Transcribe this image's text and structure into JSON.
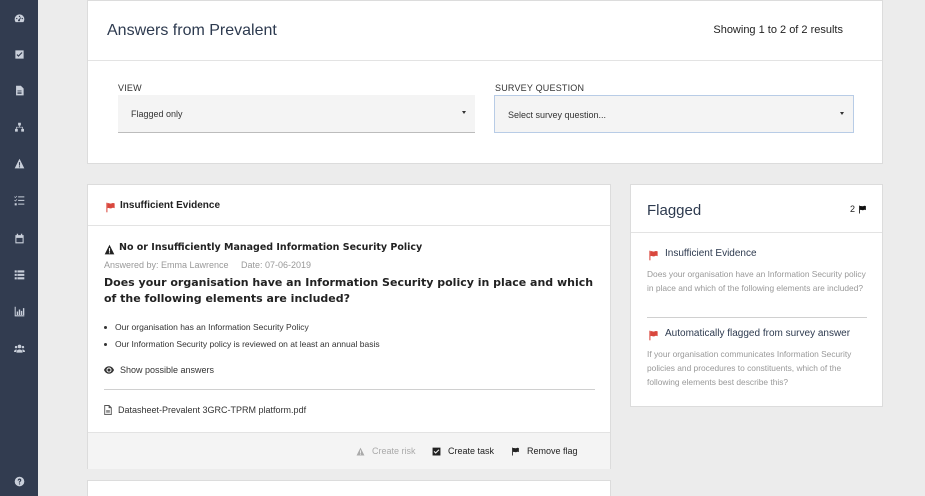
{
  "sidebar": {
    "icons": [
      "dashboard-icon",
      "checkbox-icon",
      "document-icon",
      "sitemap-icon",
      "warning-icon",
      "tasklist-icon",
      "calendar-icon",
      "list-icon",
      "chart-icon",
      "users-icon",
      "help-icon"
    ]
  },
  "header": {
    "title": "Answers from Prevalent",
    "results": "Showing 1 to 2 of 2 results"
  },
  "filters": {
    "view_label": "VIEW",
    "view_value": "Flagged only",
    "question_label": "SURVEY QUESTION",
    "question_value": "Select survey question..."
  },
  "answer": {
    "flag_title": "Insufficient Evidence",
    "risk_title": "No or Insufficiently Managed Information Security Policy",
    "answered_by": "Answered by: Emma Lawrence",
    "date": "Date: 07-06-2019",
    "question": "Does your organisation have an Information Security policy in place and which of the following elements are included?",
    "bullets": [
      "Our organisation has an Information Security Policy",
      "Our Information Security policy is reviewed on at least an annual basis"
    ],
    "show_answers": "Show possible answers",
    "file": "Datasheet-Prevalent 3GRC-TPRM platform.pdf",
    "actions": {
      "create_risk": "Create risk",
      "create_task": "Create task",
      "remove_flag": "Remove flag"
    }
  },
  "flagged": {
    "title": "Flagged",
    "count": "2",
    "items": [
      {
        "title": "Insufficient Evidence",
        "desc": "Does your organisation have an Information Security policy in place and which of the following elements are included?"
      },
      {
        "title": "Automatically flagged from survey answer",
        "desc": "If your organisation communicates Information Security policies and procedures to constituents, which of the following elements best describe this?"
      }
    ]
  },
  "colors": {
    "sidebar": "#323c50",
    "flag_red": "#d9473d",
    "title": "#2d3a4f"
  }
}
